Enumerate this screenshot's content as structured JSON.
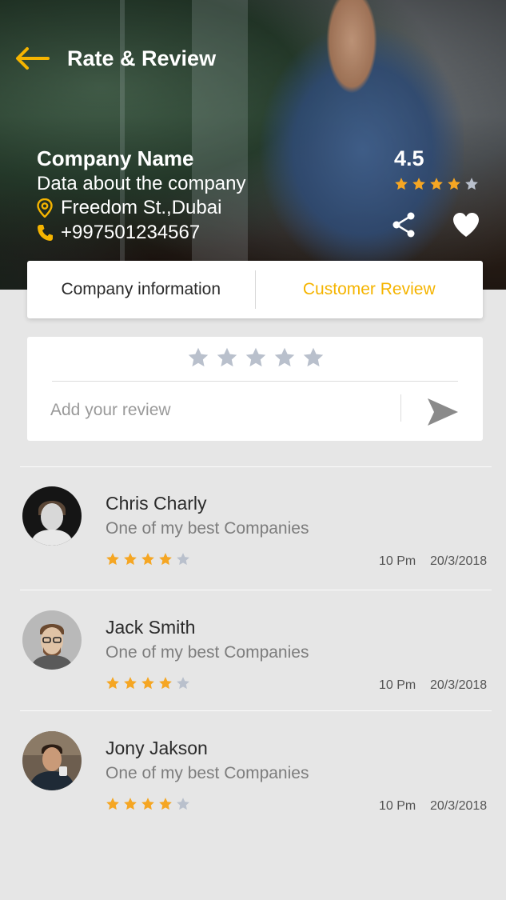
{
  "header": {
    "title": "Rate & Review"
  },
  "company": {
    "name": "Company Name",
    "about": "Data about the company",
    "location": "Freedom St.,Dubai",
    "phone": "+997501234567",
    "rating": "4.5",
    "rating_value": 4
  },
  "tabs": {
    "info_label": "Company information",
    "review_label": "Customer Review"
  },
  "review_input": {
    "placeholder": "Add your review"
  },
  "colors": {
    "accent": "#f5b400",
    "star_filled": "#f5a623",
    "star_empty": "#b9c0cc"
  },
  "reviews": [
    {
      "name": "Chris Charly",
      "text": "One of my best Companies",
      "stars": 4,
      "time": "10 Pm",
      "date": "20/3/2018"
    },
    {
      "name": "Jack Smith",
      "text": "One of my best Companies",
      "stars": 4,
      "time": "10 Pm",
      "date": "20/3/2018"
    },
    {
      "name": "Jony Jakson",
      "text": "One of my best Companies",
      "stars": 4,
      "time": "10 Pm",
      "date": "20/3/2018"
    }
  ]
}
